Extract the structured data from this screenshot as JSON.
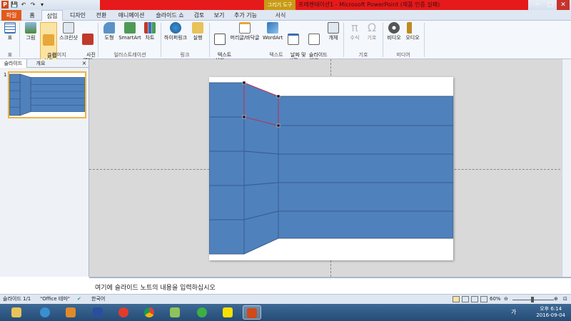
{
  "titlebar": {
    "context_tab": "그리기 도구",
    "title": "프레젠테이션1 - Microsoft PowerPoint (제품 인증 실패)",
    "minimize": "─",
    "maximize": "□",
    "close": "✕"
  },
  "tabs": {
    "file": "파일",
    "items": [
      "홈",
      "삽입",
      "디자인",
      "전환",
      "애니메이션",
      "슬라이드 쇼",
      "검토",
      "보기",
      "추가 기능"
    ],
    "context": "서식"
  },
  "ribbon": {
    "table": {
      "label": "표",
      "group": "표"
    },
    "images": {
      "picture": "그림",
      "clipart": "클립\n아트",
      "screenshot": "스크린샷",
      "album": "사진\n앨범",
      "group": "이미지"
    },
    "illustrations": {
      "shapes": "도형",
      "smartart": "SmartArt",
      "chart": "차트",
      "group": "일러스트레이션"
    },
    "links": {
      "hyperlink": "하이퍼링크",
      "action": "실행",
      "group": "링크"
    },
    "text": {
      "textbox": "텍스트\n상자",
      "headerfooter": "머리글/바닥글",
      "wordart": "WordArt",
      "datetime": "날짜 및\n시간",
      "slidenum": "슬라이드\n번호",
      "object": "개체",
      "group": "텍스트"
    },
    "symbols": {
      "equation": "수식",
      "symbol": "기호",
      "group": "기호"
    },
    "media": {
      "video": "비디오",
      "audio": "오디오",
      "group": "미디어"
    }
  },
  "panel": {
    "tab_slides": "슬라이드",
    "tab_outline": "개요",
    "close": "×",
    "slide_number": "1"
  },
  "notes": {
    "placeholder": "여기에 슬라이드 노트의 내용을 입력하십시오"
  },
  "status": {
    "slide": "슬라이드 1/1",
    "theme": "\"Office 테마\"",
    "language": "한국어",
    "zoom": "60%"
  },
  "taskbar": {
    "time": "오후 6:14",
    "date": "2016-09-04",
    "ime": "가"
  },
  "colors": {
    "shape_fill": "#4f81bd",
    "shape_line": "#385d8a",
    "selection": "#c0304f"
  }
}
